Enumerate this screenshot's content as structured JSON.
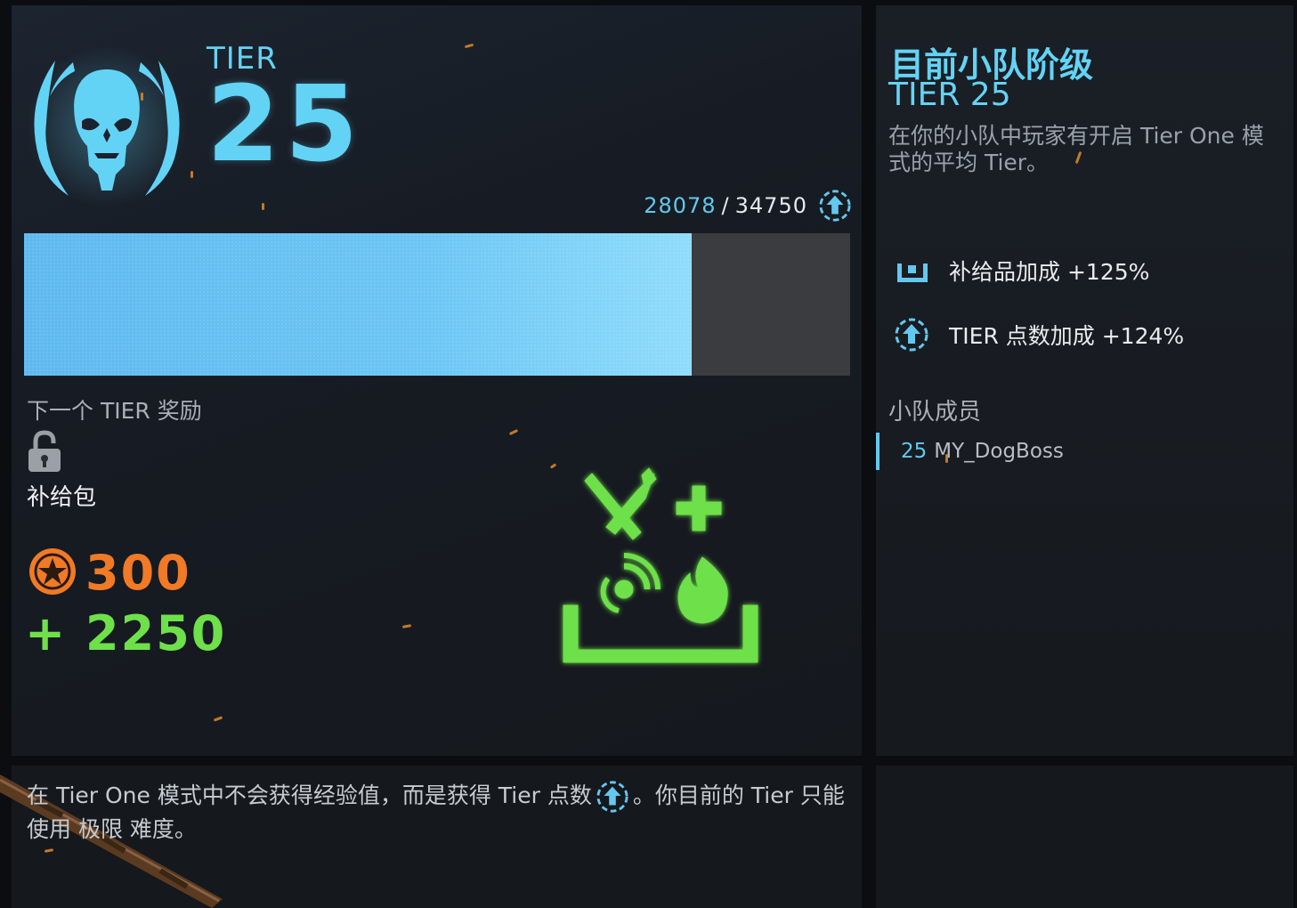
{
  "header": {
    "tier_label": "TIER",
    "tier_number": "25",
    "xp_current": "28078",
    "xp_separator": "/",
    "xp_max": "34750",
    "progress_fraction": 0.808
  },
  "next_reward": {
    "label": "下一个 TIER 奖励",
    "item_name": "补给包",
    "coin_amount": "300",
    "bonus_amount": "+ 2250"
  },
  "squad": {
    "title": "目前小队阶级",
    "tier_text": "TIER 25",
    "description": "在你的小队中玩家有开启 Tier One 模式的平均 Tier。",
    "bonuses": [
      {
        "icon": "supply-crate-icon",
        "label": "补给品加成",
        "value": "+125%"
      },
      {
        "icon": "tier-points-icon",
        "label": "TIER 点数加成",
        "value": "+124%"
      }
    ],
    "members_label": "小队成员",
    "members": [
      {
        "tier": "25",
        "name": "MY_DogBoss"
      }
    ]
  },
  "info": {
    "text_before_icon": "在 Tier One 模式中不会获得经验值，而是获得 Tier 点数",
    "text_after_icon": "。你目前的 Tier 只能使用 极限 难度。"
  },
  "colors": {
    "accent_cyan": "#63d3f5",
    "progress_blue": "#6cc6f4",
    "coin_orange": "#f07a25",
    "bonus_green": "#6ee04a"
  }
}
